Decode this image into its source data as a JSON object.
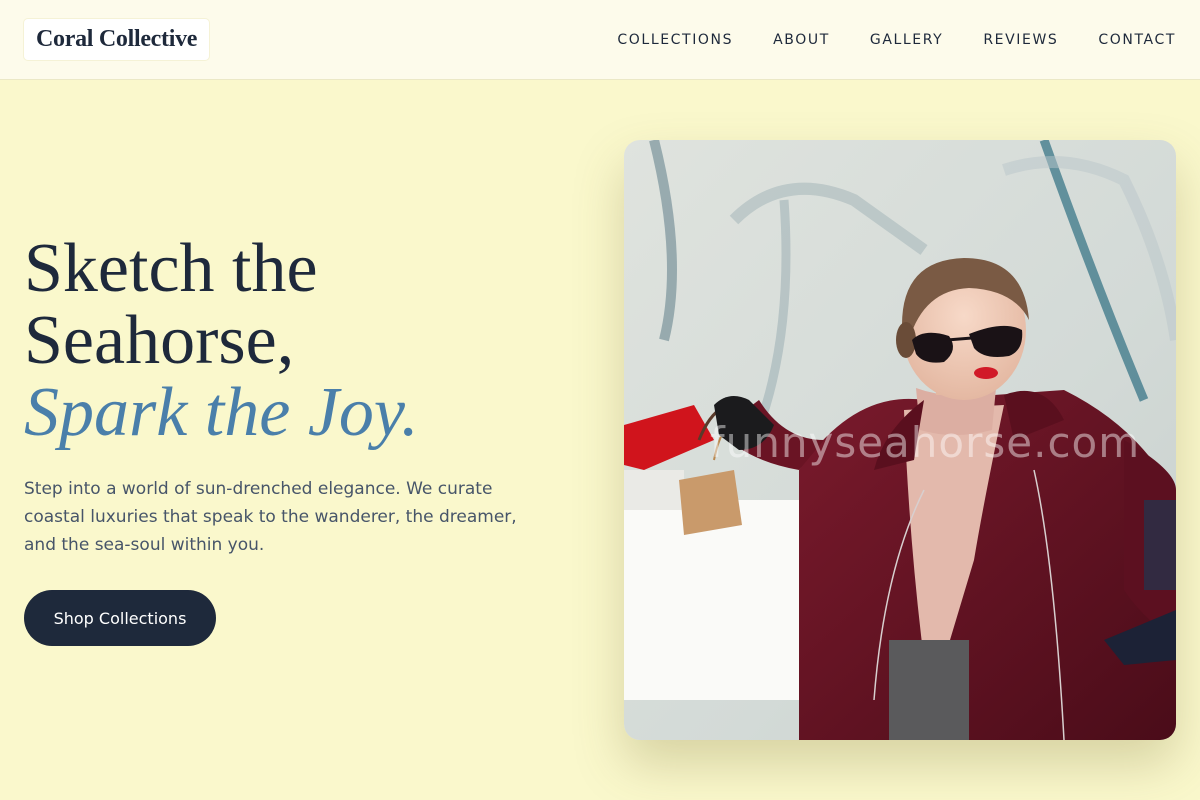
{
  "brand": {
    "name": "Coral Collective"
  },
  "nav": {
    "items": [
      {
        "label": "COLLECTIONS"
      },
      {
        "label": "ABOUT"
      },
      {
        "label": "GALLERY"
      },
      {
        "label": "REVIEWS"
      },
      {
        "label": "CONTACT"
      }
    ]
  },
  "hero": {
    "headline_line1": "Sketch the",
    "headline_line2": "Seahorse,",
    "headline_accent": "Spark the Joy.",
    "intro": "Step into a world of sun-drenched elegance. We curate coastal luxuries that speak to the wanderer, the dreamer, and the sea-soul within you.",
    "cta_label": "Shop Collections",
    "image": {
      "description_icon": "fashion-photo",
      "watermark": "funnyseahorse.com"
    }
  },
  "colors": {
    "background": "#faf8cc",
    "header": "#fdfbeb",
    "ink": "#1e293b",
    "accent": "#4a7faa",
    "body_text": "#475569",
    "cta_bg": "#1e293b"
  }
}
